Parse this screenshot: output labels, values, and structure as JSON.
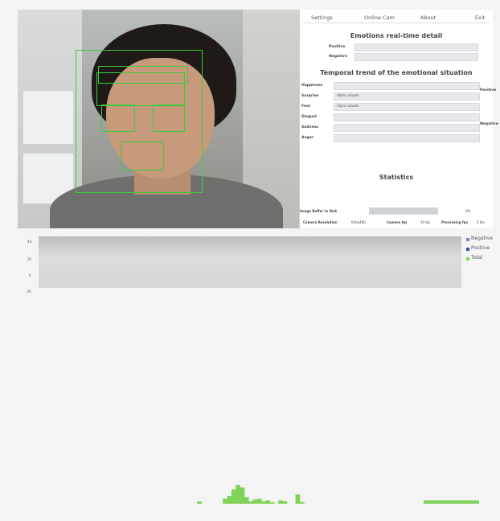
{
  "nav": {
    "items": [
      {
        "label": "Settings",
        "active": true
      },
      {
        "label": "Online Cam"
      },
      {
        "label": "About"
      },
      {
        "label": "Exit"
      }
    ]
  },
  "realtime": {
    "title": "Emotions real-time detail",
    "fields": [
      "Positive",
      "Negative"
    ]
  },
  "trend": {
    "title": "Temporal trend of the emotional situation",
    "rows": [
      "Happiness",
      "Surprise",
      "Fear",
      "Disgust",
      "Sadness",
      "Anger"
    ],
    "right_labels": [
      "Positive",
      "Negative"
    ],
    "pills": [
      "Alpha valuate",
      "Alpha valuate"
    ]
  },
  "statistics": {
    "title": "Statistics",
    "buffer_label": "Image Buffer to Disk",
    "buffer_value": "0%",
    "metrics": [
      {
        "label": "Camera Resolution",
        "value": "640x480"
      },
      {
        "label": "Camera fps",
        "value": "10 fps"
      },
      {
        "label": "Processing fps",
        "value": "5 fps"
      }
    ]
  },
  "chart_data": {
    "type": "area",
    "ylabel": "",
    "y_ticks": [
      "40",
      "20",
      "0",
      "-20"
    ],
    "ylim": [
      -20,
      40
    ],
    "x": [
      0,
      1,
      2,
      3,
      4,
      5,
      6,
      7,
      8,
      9,
      10,
      11,
      12,
      13,
      14,
      15,
      16,
      17,
      18,
      19,
      20,
      21,
      22,
      23,
      24,
      25,
      26,
      27,
      28,
      29,
      30,
      31,
      32,
      33,
      34,
      35,
      36,
      37,
      38,
      39,
      40,
      41,
      42,
      43,
      44,
      45,
      46,
      47,
      48,
      49,
      50,
      51,
      52,
      53,
      54,
      55,
      56,
      57,
      58,
      59,
      60,
      61,
      62,
      63,
      64,
      65,
      66,
      67,
      68,
      69,
      70,
      71,
      72,
      73,
      74,
      75,
      76,
      77,
      78,
      79,
      80,
      81,
      82,
      83,
      84,
      85,
      86,
      87,
      88,
      89,
      90,
      91,
      92,
      93,
      94,
      95,
      96,
      97,
      98,
      99
    ],
    "series": [
      {
        "name": "Negative",
        "color": "#7b86c9",
        "values": [
          0,
          0,
          0,
          0,
          0,
          0,
          0,
          0,
          0,
          0,
          0,
          0,
          0,
          0,
          0,
          0,
          0,
          0,
          0,
          0,
          0,
          0,
          0,
          0,
          0,
          0,
          0,
          0,
          0,
          0,
          0,
          0,
          0,
          0,
          0,
          0,
          0,
          0,
          0,
          0,
          0,
          0,
          0,
          0,
          0,
          0,
          0,
          0,
          0,
          0,
          0,
          0,
          0,
          0,
          0,
          0,
          0,
          0,
          0,
          0,
          0,
          0,
          0,
          0,
          0,
          0,
          0,
          0,
          0,
          0,
          0,
          0,
          0,
          0,
          0,
          0,
          0,
          0,
          0,
          0,
          0,
          0,
          0,
          0,
          0,
          0,
          0,
          0,
          0,
          0,
          0,
          0,
          0,
          0,
          0,
          0,
          0,
          0,
          0,
          0
        ]
      },
      {
        "name": "Positive",
        "color": "#3c4fb0",
        "values": [
          0,
          0,
          0,
          0,
          0,
          0,
          0,
          0,
          0,
          0,
          0,
          0,
          0,
          0,
          0,
          0,
          0,
          0,
          0,
          0,
          0,
          0,
          0,
          0,
          0,
          0,
          0,
          0,
          0,
          0,
          0,
          0,
          0,
          0,
          0,
          0,
          0,
          0,
          0,
          0,
          0,
          0,
          0,
          0,
          0,
          0,
          0,
          0,
          0,
          0,
          0,
          0,
          0,
          0,
          0,
          0,
          0,
          0,
          0,
          0,
          0,
          0,
          0,
          0,
          0,
          0,
          0,
          0,
          0,
          0,
          0,
          0,
          0,
          0,
          0,
          0,
          0,
          0,
          0,
          0,
          0,
          0,
          0,
          0,
          0,
          0,
          0,
          0,
          0,
          0,
          0,
          0,
          0,
          0,
          0,
          0,
          0,
          0,
          0,
          0
        ]
      },
      {
        "name": "Total",
        "color": "#7fd35a",
        "values": [
          0,
          0,
          0,
          0,
          0,
          0,
          0,
          0,
          0,
          0,
          0,
          0,
          0,
          0,
          0,
          0,
          0,
          0,
          0,
          0,
          0,
          0,
          0,
          0,
          0,
          0,
          0,
          0,
          0,
          0,
          0,
          0,
          0,
          3,
          0,
          0,
          0,
          0,
          0,
          6,
          9,
          17,
          22,
          19,
          8,
          3,
          5,
          6,
          3,
          4,
          2,
          0,
          4,
          3,
          0,
          0,
          11,
          2,
          0,
          0,
          0,
          0,
          0,
          0,
          0,
          0,
          0,
          0,
          0,
          0,
          0,
          0,
          0,
          0,
          0,
          0,
          0,
          0,
          0,
          0,
          0,
          0,
          0,
          0,
          0,
          0,
          4,
          4,
          4,
          4,
          4,
          4,
          4,
          4,
          4,
          4,
          4,
          4,
          4,
          4
        ]
      }
    ]
  }
}
